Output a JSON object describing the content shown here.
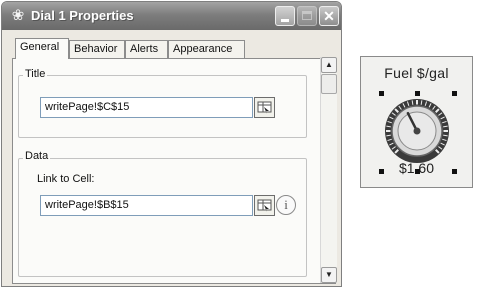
{
  "window": {
    "title": "Dial 1 Properties",
    "app_icon": "gear-icon"
  },
  "tabs": [
    {
      "label": "General",
      "active": true
    },
    {
      "label": "Behavior",
      "active": false
    },
    {
      "label": "Alerts",
      "active": false
    },
    {
      "label": "Appearance",
      "active": false
    }
  ],
  "title_section": {
    "legend": "Title",
    "value": "writePage!$C$15"
  },
  "data_section": {
    "legend": "Data",
    "link_label": "Link to Cell:",
    "value": "writePage!$B$15"
  },
  "dial": {
    "title": "Fuel $/gal",
    "value_text": "$1.60",
    "needle_level": 0.4
  }
}
